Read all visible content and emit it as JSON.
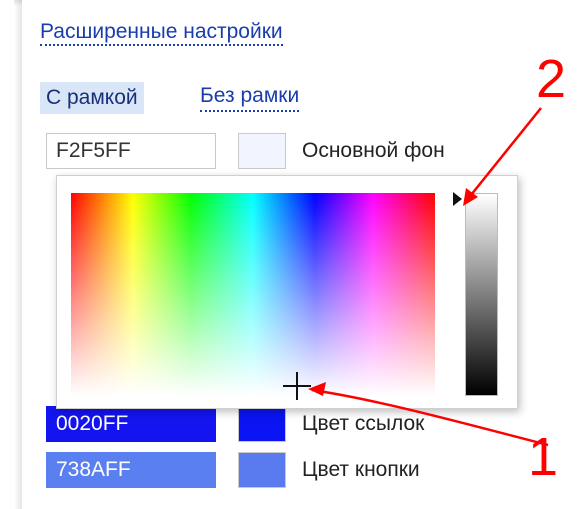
{
  "settings": {
    "advanced_link": "Расширенные настройки",
    "tabs": [
      {
        "label": "С рамкой",
        "active": true
      },
      {
        "label": "Без рамки",
        "active": false
      }
    ]
  },
  "color_rows": [
    {
      "hex": "F2F5FF",
      "swatch_color": "#f2f5ff",
      "label": "Основной фон",
      "input_bg": "#ffffff",
      "input_fg": "#333333"
    },
    {
      "hex": "0020FF",
      "swatch_color": "#0a14f2",
      "label": "Цвет ссылок",
      "input_bg": "#1414f0",
      "input_fg": "#ffffff"
    },
    {
      "hex": "738AFF",
      "swatch_color": "#5a7af0",
      "label": "Цвет кнопки",
      "input_bg": "#5a7ff0",
      "input_fg": "#ffffff"
    }
  ],
  "picker": {
    "crosshair": "crosshair-cursor",
    "brightness_pointer": "triangle-pointer"
  },
  "annotations": [
    {
      "number": "1",
      "color": "#ff0000"
    },
    {
      "number": "2",
      "color": "#ff0000"
    }
  ]
}
